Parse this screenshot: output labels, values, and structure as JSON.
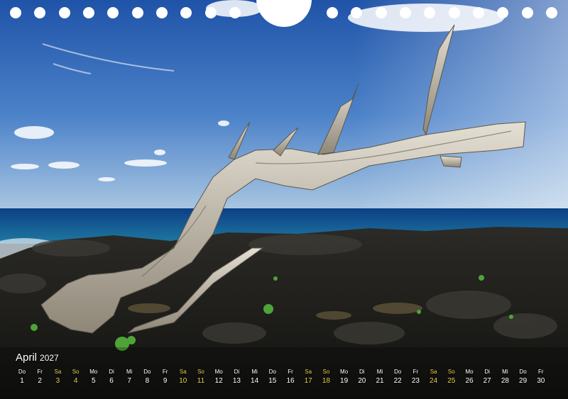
{
  "header": {
    "month": "April",
    "year": "2027"
  },
  "colors": {
    "weekend": "#e6cf4a",
    "text": "#ffffff"
  },
  "calendar": [
    {
      "dn": "Do",
      "dd": "1",
      "we": false
    },
    {
      "dn": "Fr",
      "dd": "2",
      "we": false
    },
    {
      "dn": "Sa",
      "dd": "3",
      "we": true
    },
    {
      "dn": "So",
      "dd": "4",
      "we": true
    },
    {
      "dn": "Mo",
      "dd": "5",
      "we": false
    },
    {
      "dn": "Di",
      "dd": "6",
      "we": false
    },
    {
      "dn": "Mi",
      "dd": "7",
      "we": false
    },
    {
      "dn": "Do",
      "dd": "8",
      "we": false
    },
    {
      "dn": "Fr",
      "dd": "9",
      "we": false
    },
    {
      "dn": "Sa",
      "dd": "10",
      "we": true
    },
    {
      "dn": "So",
      "dd": "11",
      "we": true
    },
    {
      "dn": "Mo",
      "dd": "12",
      "we": false
    },
    {
      "dn": "Di",
      "dd": "13",
      "we": false
    },
    {
      "dn": "Mi",
      "dd": "14",
      "we": false
    },
    {
      "dn": "Do",
      "dd": "15",
      "we": false
    },
    {
      "dn": "Fr",
      "dd": "16",
      "we": false
    },
    {
      "dn": "Sa",
      "dd": "17",
      "we": true
    },
    {
      "dn": "So",
      "dd": "18",
      "we": true
    },
    {
      "dn": "Mo",
      "dd": "19",
      "we": false
    },
    {
      "dn": "Di",
      "dd": "20",
      "we": false
    },
    {
      "dn": "Mi",
      "dd": "21",
      "we": false
    },
    {
      "dn": "Do",
      "dd": "22",
      "we": false
    },
    {
      "dn": "Fr",
      "dd": "23",
      "we": false
    },
    {
      "dn": "Sa",
      "dd": "24",
      "we": true
    },
    {
      "dn": "So",
      "dd": "25",
      "we": true
    },
    {
      "dn": "Mo",
      "dd": "26",
      "we": false
    },
    {
      "dn": "Di",
      "dd": "27",
      "we": false
    },
    {
      "dn": "Mi",
      "dd": "28",
      "we": false
    },
    {
      "dn": "Do",
      "dd": "29",
      "we": false
    },
    {
      "dn": "Fr",
      "dd": "30",
      "we": false
    }
  ]
}
